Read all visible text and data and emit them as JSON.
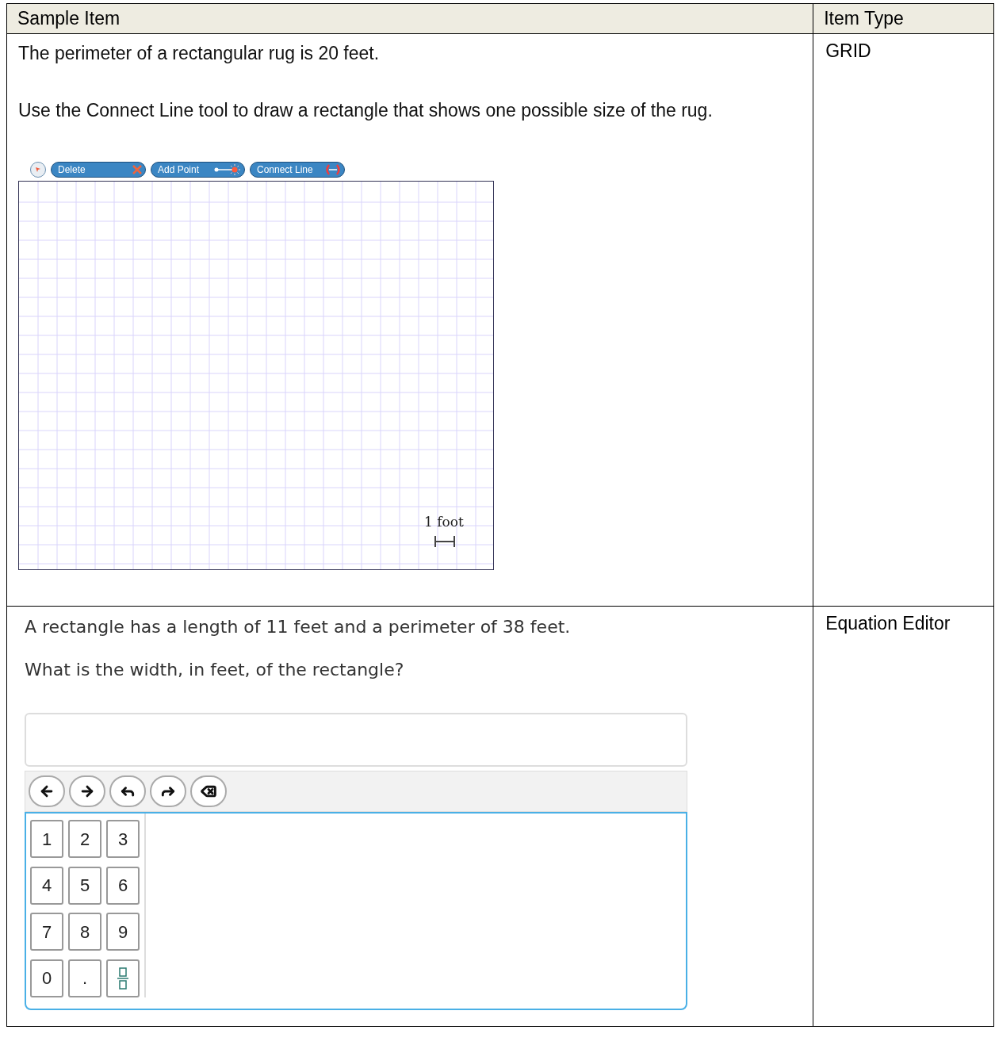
{
  "table": {
    "columns": [
      "Sample Item",
      "Item Type"
    ],
    "rows": [
      {
        "kind": "grid",
        "item_type": "GRID",
        "prompt": [
          "The perimeter of a rectangular rug is 20 feet.",
          "Use the Connect Line tool to draw a rectangle that shows one possible size of the rug."
        ],
        "tools": [
          {
            "kind": "delete",
            "label": "Delete"
          },
          {
            "kind": "add_point",
            "label": "Add Point"
          },
          {
            "kind": "connect_line",
            "label": "Connect Line"
          }
        ],
        "scale_label": "1 foot"
      },
      {
        "kind": "equation",
        "item_type": "Equation Editor",
        "prompt": [
          "A rectangle has a length of 11 feet and a perimeter of 38 feet.",
          "What is the width, in feet, of the rectangle?"
        ],
        "keys": [
          {
            "kind": "digit",
            "label": "1"
          },
          {
            "kind": "digit",
            "label": "2"
          },
          {
            "kind": "digit",
            "label": "3"
          },
          {
            "kind": "digit",
            "label": "4"
          },
          {
            "kind": "digit",
            "label": "5"
          },
          {
            "kind": "digit",
            "label": "6"
          },
          {
            "kind": "digit",
            "label": "7"
          },
          {
            "kind": "digit",
            "label": "8"
          },
          {
            "kind": "digit",
            "label": "9"
          },
          {
            "kind": "digit",
            "label": "0"
          },
          {
            "kind": "digit",
            "label": "."
          },
          {
            "kind": "fraction"
          }
        ]
      }
    ]
  }
}
